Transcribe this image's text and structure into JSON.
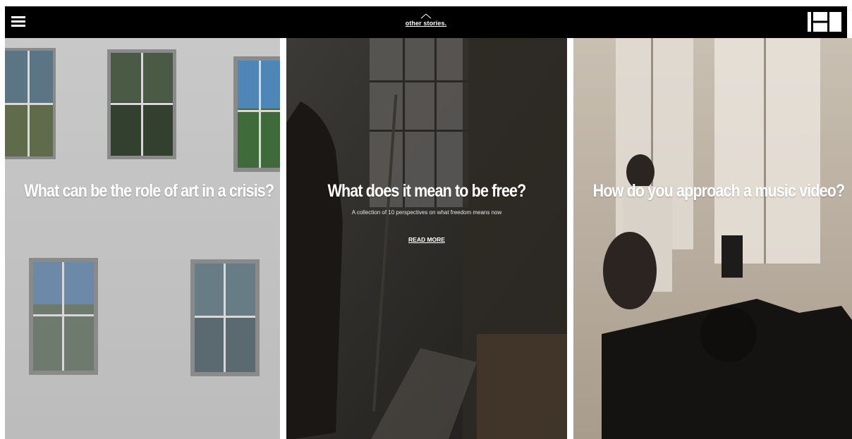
{
  "header": {
    "logo_text": "other stories.",
    "menu_icon": "hamburger-menu-icon",
    "layout_icon": "grid-layout-icon"
  },
  "panels": [
    {
      "title": "What can be the role of art in a crisis?",
      "image": "windows-on-grey-wall"
    },
    {
      "title": "What does it mean to be free?",
      "subtitle": "A collection of 10 perspectives on what freedom means now",
      "cta": "READ MORE",
      "image": "figure-in-dark-studio-with-easel"
    },
    {
      "title": "How do you approach a music video?",
      "image": "camera-operator-on-set"
    }
  ],
  "colors": {
    "bar": "#000000",
    "text": "#ffffff"
  }
}
